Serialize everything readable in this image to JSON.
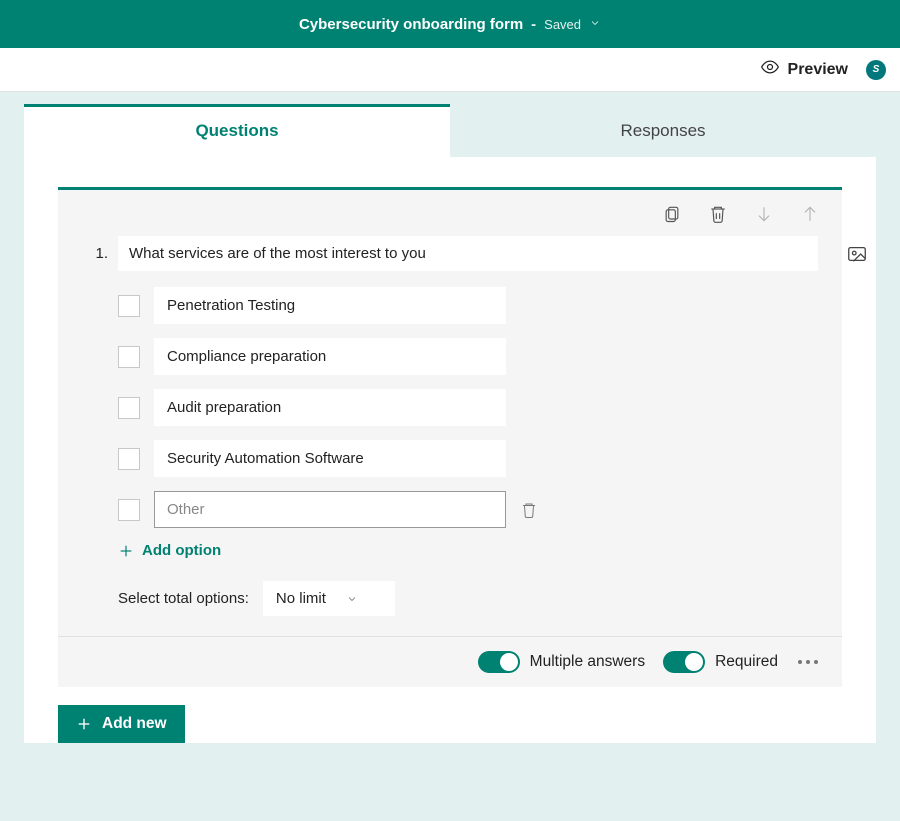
{
  "header": {
    "form_title": "Cybersecurity onboarding form",
    "dash": "-",
    "save_status": "Saved"
  },
  "toolbar": {
    "preview_label": "Preview",
    "avatar_initial": "S"
  },
  "tabs": {
    "questions": "Questions",
    "responses": "Responses"
  },
  "question": {
    "number": "1.",
    "text": "What services are of the most interest to you",
    "options": [
      {
        "label": "Penetration Testing"
      },
      {
        "label": "Compliance preparation"
      },
      {
        "label": "Audit preparation"
      },
      {
        "label": "Security Automation Software"
      }
    ],
    "editing_option_placeholder": "Other",
    "add_option_label": "Add option",
    "select_total_label": "Select total options:",
    "select_total_value": "No limit"
  },
  "footer": {
    "multiple_answers_label": "Multiple answers",
    "required_label": "Required"
  },
  "add_new_label": "Add new"
}
